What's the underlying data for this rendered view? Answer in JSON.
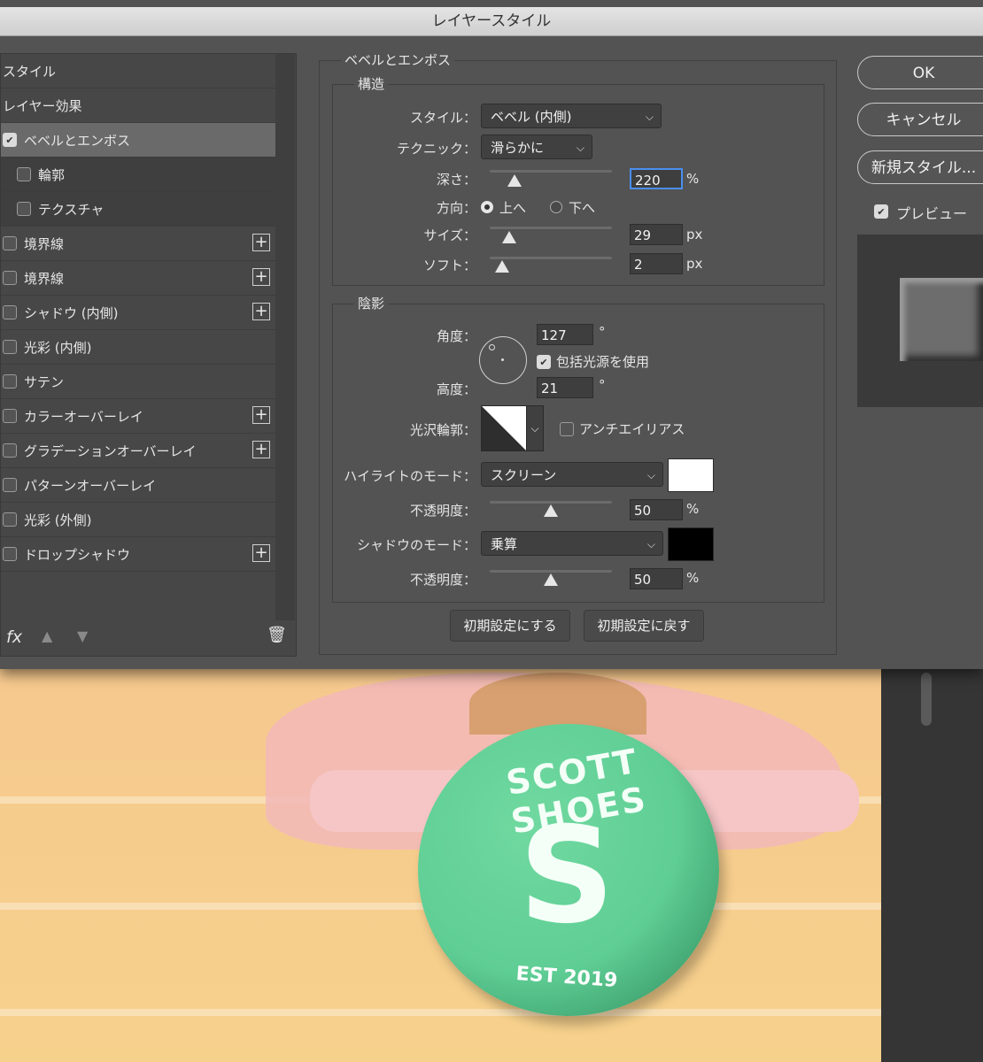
{
  "dialog": {
    "title": "レイヤースタイル"
  },
  "left_panel": {
    "items": [
      {
        "label": "スタイル"
      },
      {
        "label": "レイヤー効果"
      },
      {
        "label": "ベベルとエンボス",
        "checked": true,
        "selected": true
      },
      {
        "label": "輪郭",
        "checked": false,
        "sub": true
      },
      {
        "label": "テクスチャ",
        "checked": false,
        "sub": true
      },
      {
        "label": "境界線",
        "checked": false,
        "plus": true
      },
      {
        "label": "境界線",
        "checked": false,
        "plus": true
      },
      {
        "label": "シャドウ (内側)",
        "checked": false,
        "plus": true
      },
      {
        "label": "光彩 (内側)",
        "checked": false
      },
      {
        "label": "サテン",
        "checked": false
      },
      {
        "label": "カラーオーバーレイ",
        "checked": false,
        "plus": true
      },
      {
        "label": "グラデーションオーバーレイ",
        "checked": false,
        "plus": true
      },
      {
        "label": "パターンオーバーレイ",
        "checked": false
      },
      {
        "label": "光彩 (外側)",
        "checked": false
      },
      {
        "label": "ドロップシャドウ",
        "checked": false,
        "plus": true
      }
    ],
    "footer": {
      "fx": "fx"
    }
  },
  "bevel": {
    "section_title": "ベベルとエンボス",
    "structure": {
      "title": "構造",
      "style_label": "スタイル：",
      "style_value": "ベベル (内側)",
      "technique_label": "テクニック：",
      "technique_value": "滑らかに",
      "depth_label": "深さ：",
      "depth_value": "220",
      "depth_unit": "%",
      "depth_slider": 0.2,
      "direction_label": "方向：",
      "direction_up": "上へ",
      "direction_down": "下へ",
      "direction_selected": "up",
      "size_label": "サイズ：",
      "size_value": "29",
      "size_unit": "px",
      "size_slider": 0.16,
      "soften_label": "ソフト：",
      "soften_value": "2",
      "soften_unit": "px",
      "soften_slider": 0.1
    },
    "shading": {
      "title": "陰影",
      "angle_label": "角度：",
      "angle_value": "127",
      "angle_unit": "°",
      "global_light_label": "包括光源を使用",
      "global_light": true,
      "altitude_label": "高度：",
      "altitude_value": "21",
      "altitude_unit": "°",
      "gloss_label": "光沢輪郭：",
      "antialias_label": "アンチエイリアス",
      "antialias": false,
      "highlight_mode_label": "ハイライトのモード：",
      "highlight_mode": "スクリーン",
      "highlight_color": "#ffffff",
      "highlight_opacity_label": "不透明度：",
      "highlight_opacity": "50",
      "highlight_opacity_unit": "%",
      "highlight_opacity_slider": 0.5,
      "shadow_mode_label": "シャドウのモード：",
      "shadow_mode": "乗算",
      "shadow_color": "#000000",
      "shadow_opacity_label": "不透明度：",
      "shadow_opacity": "50",
      "shadow_opacity_unit": "%",
      "shadow_opacity_slider": 0.5
    },
    "make_default": "初期設定にする",
    "reset_default": "初期設定に戻す"
  },
  "right": {
    "ok": "OK",
    "cancel": "キャンセル",
    "new_style": "新規スタイル...",
    "preview_label": "プレビュー",
    "preview": true
  },
  "canvas": {
    "badge_top": "SCOTT SHOES",
    "badge_mark": "S",
    "badge_bottom": "EST 2019"
  }
}
